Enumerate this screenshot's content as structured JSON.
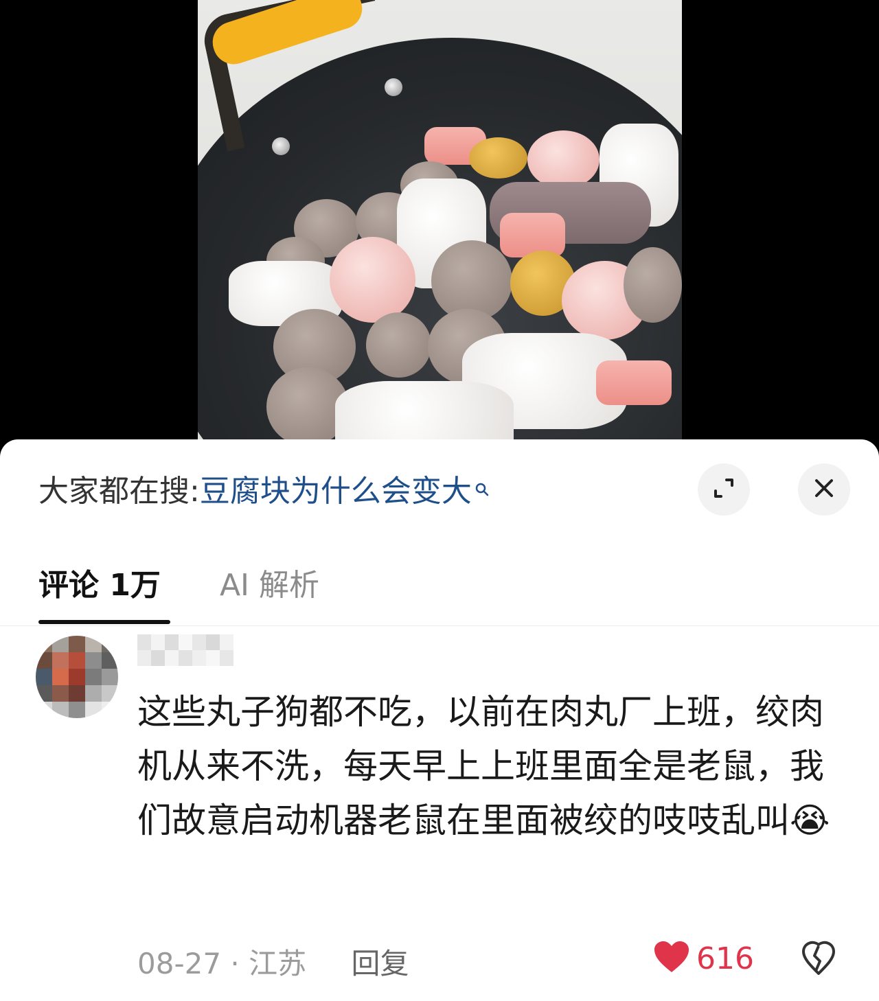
{
  "search_bar": {
    "prefix": "大家都在搜:",
    "query": "豆腐块为什么会变大"
  },
  "buttons": {
    "expand_icon": "expand-icon",
    "close_icon": "close-icon"
  },
  "tabs": [
    {
      "label": "评论 1万",
      "active": true
    },
    {
      "label": "AI 解析",
      "active": false
    }
  ],
  "comment": {
    "text": "这些丸子狗都不吃，以前在肉丸厂上班，绞肉机从来不洗，每天早上上班里面全是老鼠，我们故意启动机器老鼠在里面被绞的吱吱乱叫",
    "emoji": "😭",
    "date": "08-27",
    "separator": "·",
    "location": "江苏",
    "reply_label": "回复",
    "likes": "616"
  },
  "colors": {
    "accent_link": "#1e4f8a",
    "like_red": "#e0344a",
    "grip_yellow": "#f4b21e"
  }
}
